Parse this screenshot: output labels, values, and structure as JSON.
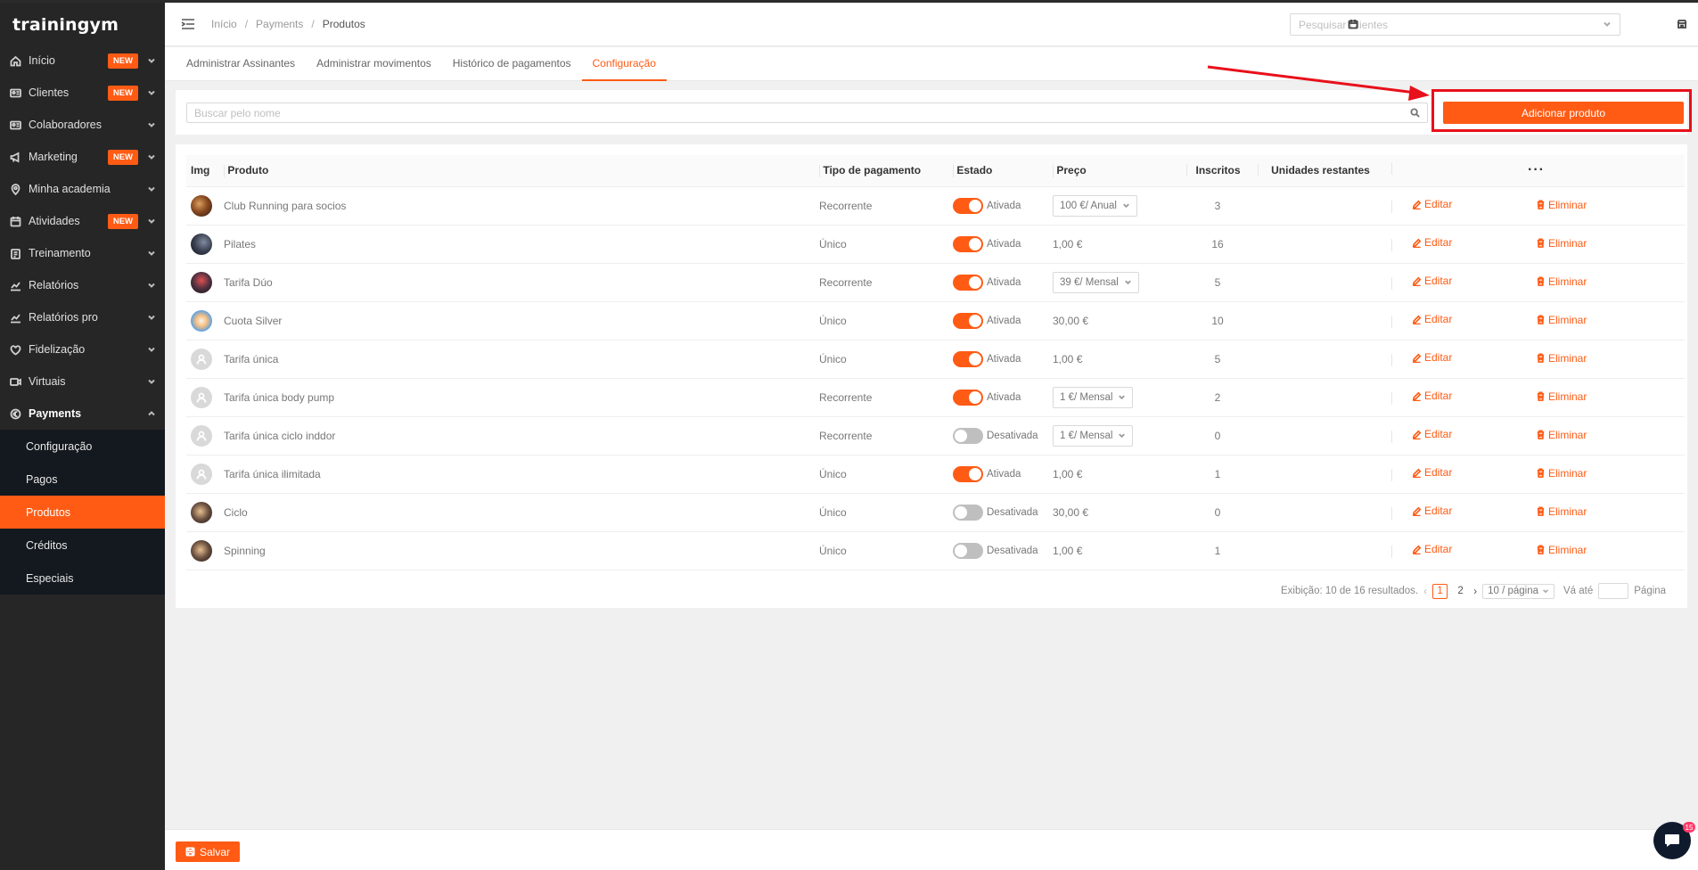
{
  "brand": {
    "logo": "trainingym"
  },
  "sidebar": {
    "items": [
      {
        "label": "Início",
        "icon": "home-icon",
        "badge": "NEW"
      },
      {
        "label": "Clientes",
        "icon": "id-card-icon",
        "badge": "NEW"
      },
      {
        "label": "Colaboradores",
        "icon": "id-card-icon",
        "badge": ""
      },
      {
        "label": "Marketing",
        "icon": "megaphone-icon",
        "badge": "NEW"
      },
      {
        "label": "Minha academia",
        "icon": "location-pin-icon",
        "badge": ""
      },
      {
        "label": "Atividades",
        "icon": "calendar-icon",
        "badge": "NEW"
      },
      {
        "label": "Treinamento",
        "icon": "clipboard-icon",
        "badge": ""
      },
      {
        "label": "Relatórios",
        "icon": "line-chart-icon",
        "badge": ""
      },
      {
        "label": "Relatórios pro",
        "icon": "line-chart-icon",
        "badge": ""
      },
      {
        "label": "Fidelização",
        "icon": "heart-icon",
        "badge": ""
      },
      {
        "label": "Virtuais",
        "icon": "video-icon",
        "badge": ""
      },
      {
        "label": "Payments",
        "icon": "euro-circle-icon",
        "badge": ""
      }
    ],
    "sub_items": [
      "Configuração",
      "Pagos",
      "Produtos",
      "Créditos",
      "Especiais"
    ],
    "active_sub": "Produtos"
  },
  "header": {
    "breadcrumb": [
      "Início",
      "Payments",
      "Produtos"
    ],
    "search_placeholder": "Pesquisar Clientes"
  },
  "tabs": [
    "Administrar Assinantes",
    "Administrar movimentos",
    "Histórico de pagamentos",
    "Configuração"
  ],
  "active_tab": "Configuração",
  "search": {
    "placeholder": "Buscar pelo nome",
    "add_button": "Adicionar produto"
  },
  "table": {
    "headers": {
      "img": "Img",
      "product": "Produto",
      "payment_type": "Tipo de pagamento",
      "state": "Estado",
      "price": "Preço",
      "enrolled": "Inscritos",
      "remaining": "Unidades restantes",
      "more": "···"
    },
    "actions": {
      "edit": "Editar",
      "delete": "Eliminar"
    },
    "rows": [
      {
        "name": "Club Running para socios",
        "type": "Recorrente",
        "active": true,
        "state": "Ativada",
        "price": "100 €/ Anual",
        "price_select": true,
        "enrolled": "3"
      },
      {
        "name": "Pilates",
        "type": "Único",
        "active": true,
        "state": "Ativada",
        "price": "1,00 €",
        "price_select": false,
        "enrolled": "16"
      },
      {
        "name": "Tarifa Dúo",
        "type": "Recorrente",
        "active": true,
        "state": "Ativada",
        "price": "39 €/ Mensal",
        "price_select": true,
        "enrolled": "5"
      },
      {
        "name": "Cuota Silver",
        "type": "Único",
        "active": true,
        "state": "Ativada",
        "price": "30,00 €",
        "price_select": false,
        "enrolled": "10"
      },
      {
        "name": "Tarifa única",
        "type": "Único",
        "active": true,
        "state": "Ativada",
        "price": "1,00 €",
        "price_select": false,
        "enrolled": "5"
      },
      {
        "name": "Tarifa única body pump",
        "type": "Recorrente",
        "active": true,
        "state": "Ativada",
        "price": "1 €/ Mensal",
        "price_select": true,
        "enrolled": "2"
      },
      {
        "name": "Tarifa única ciclo inddor",
        "type": "Recorrente",
        "active": false,
        "state": "Desativada",
        "price": "1 €/ Mensal",
        "price_select": true,
        "enrolled": "0"
      },
      {
        "name": "Tarifa única ilimitada",
        "type": "Único",
        "active": true,
        "state": "Ativada",
        "price": "1,00 €",
        "price_select": false,
        "enrolled": "1"
      },
      {
        "name": "Ciclo",
        "type": "Único",
        "active": false,
        "state": "Desativada",
        "price": "30,00 €",
        "price_select": false,
        "enrolled": "0"
      },
      {
        "name": "Spinning",
        "type": "Único",
        "active": false,
        "state": "Desativada",
        "price": "1,00 €",
        "price_select": false,
        "enrolled": "1"
      }
    ]
  },
  "pagination": {
    "summary": "Exibição: 10 de 16 resultados.",
    "pages": [
      "1",
      "2"
    ],
    "current": "1",
    "page_size": "10 / página",
    "goto_label": "Vá até",
    "page_label": "Página"
  },
  "footer": {
    "save": "Salvar"
  },
  "chat": {
    "badge": "15"
  },
  "colors": {
    "accent": "#ff5b14",
    "sidebar_bg": "#262626",
    "highlight": "#e8101a"
  }
}
